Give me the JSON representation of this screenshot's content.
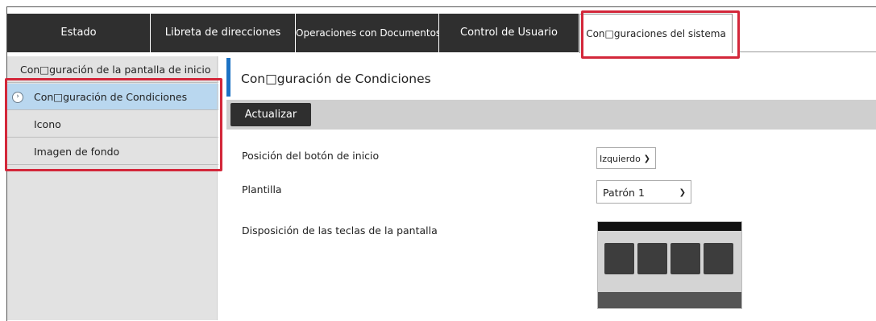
{
  "tabs": [
    {
      "label": "Estado"
    },
    {
      "label": "Libreta de direcciones"
    },
    {
      "label": "Operaciones con Documentos"
    },
    {
      "label": "Control de Usuario"
    },
    {
      "label": "Con□guraciones del sistema"
    }
  ],
  "sidebar": {
    "heading": "Con□guración de la pantalla de inicio",
    "items": [
      {
        "label": "Con□guración de Condiciones",
        "active": true
      },
      {
        "label": "Icono"
      },
      {
        "label": "Imagen de fondo"
      }
    ]
  },
  "main": {
    "title": "Con□guración de Condiciones",
    "update_button": "Actualizar",
    "fields": [
      {
        "label": "Posición del botón de inicio",
        "value": "Izquierdo"
      },
      {
        "label": "Plantilla",
        "value": "Patrón 1"
      },
      {
        "label": "Disposición de las teclas de la pantalla"
      }
    ]
  },
  "colors": {
    "accent": "#1c72c4",
    "highlight": "#d3273a",
    "active_item": "#b9d7ef",
    "dark": "#2f2f2f"
  }
}
